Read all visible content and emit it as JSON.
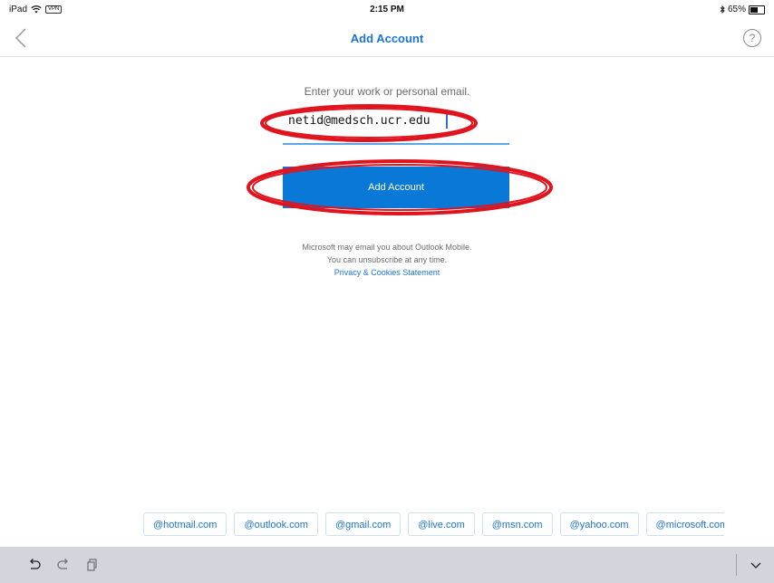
{
  "status_bar": {
    "device": "iPad",
    "vpn": "VPN",
    "time": "2:15 PM",
    "battery": "65%",
    "battery_level": 0.65
  },
  "nav": {
    "title": "Add Account",
    "help": "?"
  },
  "form": {
    "prompt": "Enter your work or personal email.",
    "email_value": "netid@medsch.ucr.edu",
    "button_label": "Add Account"
  },
  "disclaimer": {
    "line1": "Microsoft may email you about Outlook Mobile.",
    "line2": "You can unsubscribe at any time.",
    "link": "Privacy & Cookies Statement"
  },
  "suggestions": [
    "@hotmail.com",
    "@outlook.com",
    "@gmail.com",
    "@live.com",
    "@msn.com",
    "@yahoo.com",
    "@microsoft.com"
  ],
  "colors": {
    "accent": "#0a78d7",
    "link": "#1a73d9",
    "annotation": "#e0141e"
  },
  "icons": [
    "wifi-icon",
    "bluetooth-icon",
    "battery-icon",
    "back-chevron-icon",
    "help-icon",
    "undo-icon",
    "redo-icon",
    "paste-icon",
    "dismiss-keyboard-icon"
  ]
}
